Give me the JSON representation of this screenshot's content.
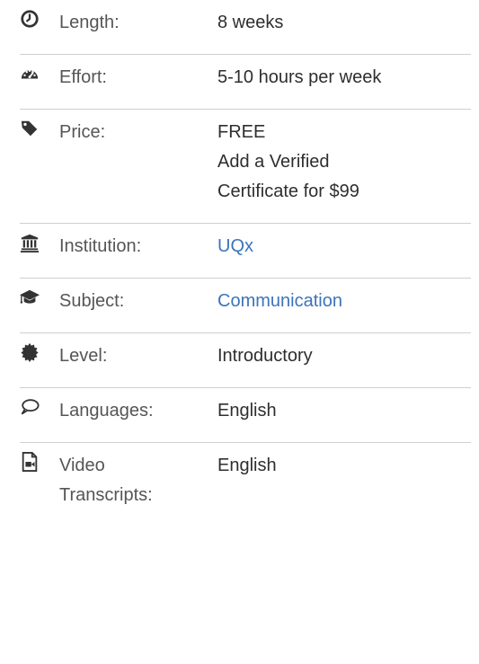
{
  "facts": {
    "length": {
      "label": "Length:",
      "value": "8 weeks",
      "icon": "clock-icon"
    },
    "effort": {
      "label": "Effort:",
      "value": "5-10 hours per week",
      "icon": "gauge-icon"
    },
    "price": {
      "label": "Price:",
      "lines": [
        "FREE",
        "Add a Verified",
        "Certificate for $99"
      ],
      "icon": "tag-icon"
    },
    "institution": {
      "label": "Institution:",
      "value": "UQx",
      "icon": "institution-icon"
    },
    "subject": {
      "label": "Subject:",
      "value": "Communication",
      "icon": "graduation-cap-icon"
    },
    "level": {
      "label": "Level:",
      "value": "Introductory",
      "icon": "badge-icon"
    },
    "languages": {
      "label": "Languages:",
      "value": "English",
      "icon": "speech-bubble-icon"
    },
    "video_transcripts": {
      "label_lines": [
        "Video",
        "Transcripts:"
      ],
      "value": "English",
      "icon": "video-file-icon"
    }
  },
  "colors": {
    "link": "#3c74b8",
    "divider": "#cfcfcf",
    "icon": "#333333"
  }
}
